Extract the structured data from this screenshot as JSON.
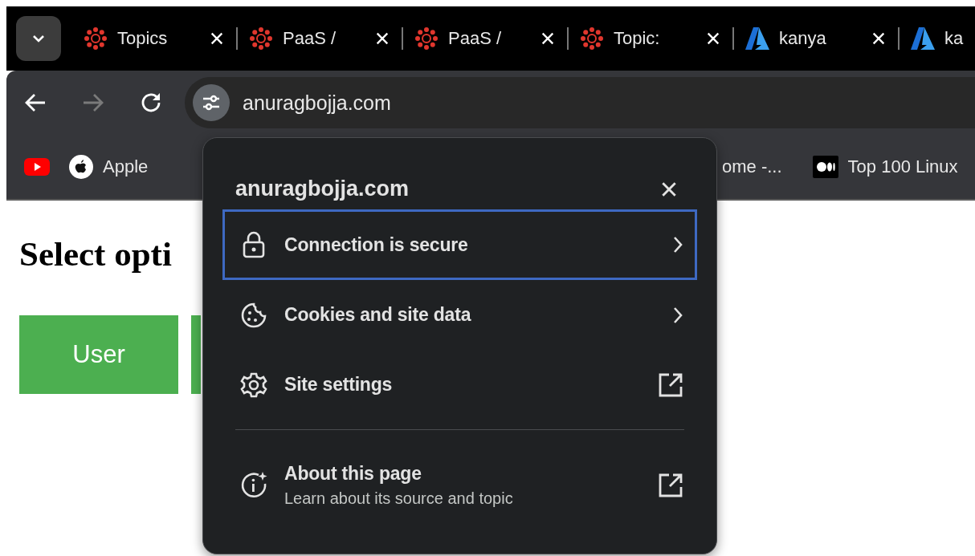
{
  "tab_strip": {
    "tabs": [
      {
        "title": "Topics",
        "kind": "canvas",
        "selected": false
      },
      {
        "title": "PaaS /",
        "kind": "canvas",
        "selected": false
      },
      {
        "title": "PaaS /",
        "kind": "canvas",
        "selected": false
      },
      {
        "title": "Topic:",
        "kind": "canvas",
        "selected": false
      },
      {
        "title": "kanya",
        "kind": "azure",
        "selected": false
      },
      {
        "title": "ka",
        "kind": "azure",
        "selected": false
      }
    ]
  },
  "toolbar": {
    "url": "anuragbojja.com",
    "forward_disabled": true
  },
  "bookmarks": [
    {
      "kind": "youtube"
    },
    {
      "title": "Apple",
      "kind": "apple"
    },
    {
      "title": "ome -...",
      "kind": "none"
    },
    {
      "title": "Top 100 Linux",
      "kind": "medium"
    }
  ],
  "page": {
    "heading": "Select opti",
    "buttons": [
      {
        "label": "User"
      }
    ]
  },
  "site_info": {
    "title": "anuragbojja.com",
    "items": [
      {
        "label": "Connection is secure",
        "kind": "security",
        "focused": true
      },
      {
        "label": "Cookies and site data",
        "kind": "cookies",
        "focused": false
      },
      {
        "label": "Site settings",
        "kind": "settings",
        "focused": false
      },
      {
        "label": "About this page",
        "subtitle": "Learn about its source and topic",
        "kind": "about",
        "focused": false,
        "divider_before": true
      }
    ]
  }
}
